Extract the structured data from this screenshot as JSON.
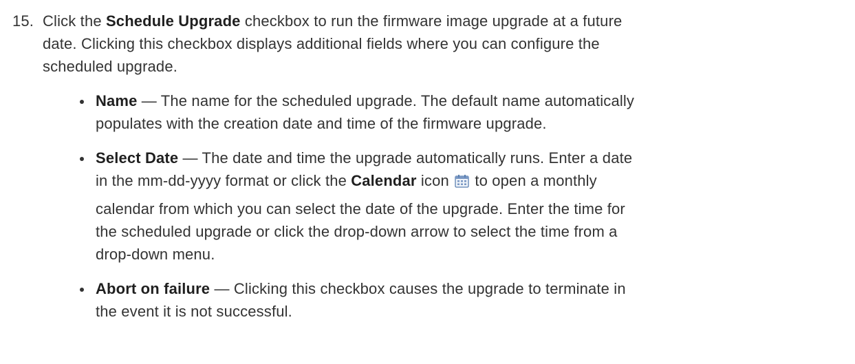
{
  "step": {
    "number": "15.",
    "intro_prefix": "Click the",
    "intro_bold": "Schedule Upgrade",
    "intro_line1_suffix": "checkbox to run the firmware image upgrade at a future",
    "intro_line2": "date. Clicking this checkbox displays additional fields where you can configure the",
    "intro_line3": "scheduled upgrade."
  },
  "bullets": {
    "name": {
      "term": "Name",
      "line1": "— The name for the scheduled upgrade. The default name automatically",
      "line2": "populates with the creation date and time of the firmware upgrade."
    },
    "select_date": {
      "term": "Select Date",
      "line1": "— The date and time the upgrade automatically runs. Enter a date",
      "line2_prefix": "in the mm-dd-yyyy format or click the",
      "calendar_bold": "Calendar",
      "line2_mid": "icon",
      "line2_suffix": "to open a monthly",
      "line3": "calendar from which you can select the date of the upgrade. Enter the time for",
      "line4": "the scheduled upgrade or click the drop-down arrow to select the time from a",
      "line5": "drop-down menu."
    },
    "abort": {
      "term": "Abort on failure",
      "line1": "— Clicking this checkbox causes the upgrade to terminate in",
      "line2": "the event it is not successful."
    }
  },
  "icons": {
    "calendar": "calendar-icon"
  },
  "colors": {
    "text": "#333333",
    "icon_blue": "#5b7fb0"
  }
}
